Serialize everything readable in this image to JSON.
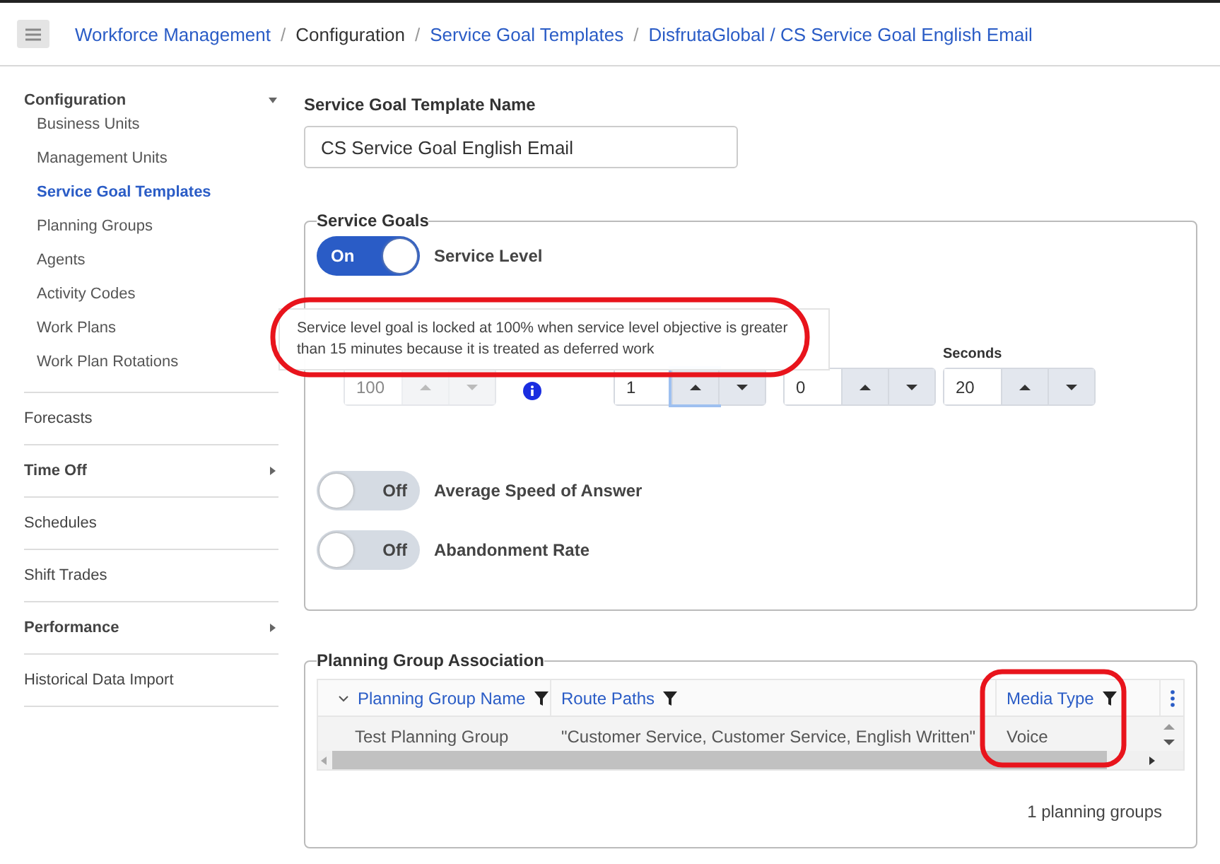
{
  "breadcrumbs": [
    {
      "label": "Workforce Management",
      "link": true
    },
    {
      "separator": "/",
      "label": "Configuration",
      "link": false
    },
    {
      "separator": "/",
      "label": "Service Goal Templates",
      "link": true
    },
    {
      "separator": "/",
      "label": "DisfrutaGlobal / CS Service Goal English Email",
      "link": true
    }
  ],
  "sidebar": {
    "items": [
      {
        "label": "Configuration",
        "expanded": true,
        "children": [
          {
            "label": "Business Units",
            "selected": false
          },
          {
            "label": "Management Units",
            "selected": false
          },
          {
            "label": "Service Goal Templates",
            "selected": true
          },
          {
            "label": "Planning Groups",
            "selected": false
          },
          {
            "label": "Agents",
            "selected": false
          },
          {
            "label": "Activity Codes",
            "selected": false
          },
          {
            "label": "Work Plans",
            "selected": false
          },
          {
            "label": "Work Plan Rotations",
            "selected": false
          }
        ]
      },
      {
        "label": "Forecasts"
      },
      {
        "label": "Time Off",
        "expanded": false
      },
      {
        "label": "Schedules"
      },
      {
        "label": "Shift Trades"
      },
      {
        "label": "Performance",
        "expanded": false
      },
      {
        "label": "Historical Data Import"
      }
    ]
  },
  "template_name": {
    "label": "Service Goal Template Name",
    "value": "CS Service Goal English Email"
  },
  "service_goals": {
    "title": "Service Goals",
    "service_level": {
      "toggle": {
        "text": "On",
        "on": true
      },
      "label": "Service Level"
    },
    "tooltip": "Service level goal is locked at 100% when service level objective is greater than 15 minutes because it is treated as deferred work",
    "spinners": [
      {
        "value": "100",
        "disabled": true,
        "up_focused": false
      },
      {
        "value": "1",
        "disabled": false,
        "up_focused": true
      },
      {
        "value": "0",
        "disabled": false,
        "up_focused": false
      },
      {
        "label": "Seconds",
        "value": "20",
        "disabled": false,
        "up_focused": false
      }
    ],
    "toggles": [
      {
        "text": "Off",
        "on": false,
        "label": "Average Speed of Answer"
      },
      {
        "text": "Off",
        "on": false,
        "label": "Abandonment Rate"
      }
    ]
  },
  "planning_groups": {
    "title": "Planning Group Association",
    "columns": [
      {
        "label": "Planning Group Name",
        "sorted": true
      },
      {
        "label": "Route Paths",
        "sorted": false
      },
      {
        "label": "Media Type",
        "sorted": false
      }
    ],
    "rows": [
      [
        "Test Planning Group",
        "\"Customer Service, Customer Service, English Written\"",
        "Voice"
      ]
    ],
    "footer": "1 planning groups"
  }
}
